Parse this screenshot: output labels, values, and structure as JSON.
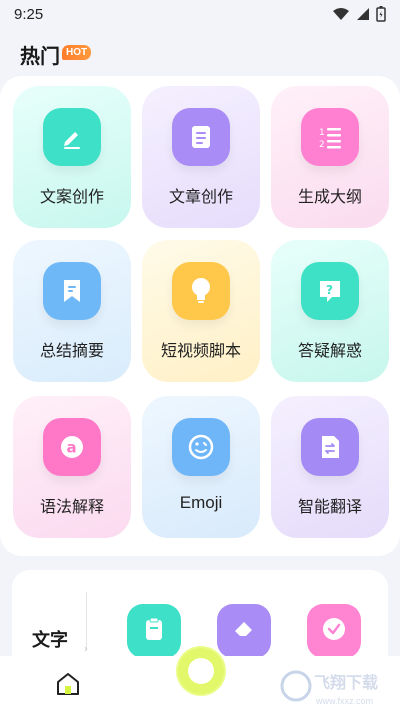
{
  "status_bar": {
    "time": "9:25"
  },
  "section": {
    "title": "热门",
    "badge": "HOT"
  },
  "cards": [
    {
      "label": "文案创作",
      "icon": "edit-pen-icon",
      "tile_color": "#3fe0c8"
    },
    {
      "label": "文章创作",
      "icon": "document-icon",
      "tile_color": "#a98cf5"
    },
    {
      "label": "生成大纲",
      "icon": "numbered-list-icon",
      "tile_color": "#ff7fd0"
    },
    {
      "label": "总结摘要",
      "icon": "bookmark-icon",
      "tile_color": "#6fb8f7"
    },
    {
      "label": "短视频脚本",
      "icon": "lightbulb-icon",
      "tile_color": "#ffc84a"
    },
    {
      "label": "答疑解惑",
      "icon": "question-bubble-icon",
      "tile_color": "#3ee0c6"
    },
    {
      "label": "语法解释",
      "icon": "letter-a-icon",
      "tile_color": "#ff78c8"
    },
    {
      "label": "Emoji",
      "icon": "smiley-icon",
      "tile_color": "#6fb6f8"
    },
    {
      "label": "智能翻译",
      "icon": "translate-doc-icon",
      "tile_color": "#a48af4"
    }
  ],
  "bottom_section": {
    "label": "文字"
  },
  "watermark_text": "飞翔下载",
  "watermark_url": "www.fxxz.com"
}
